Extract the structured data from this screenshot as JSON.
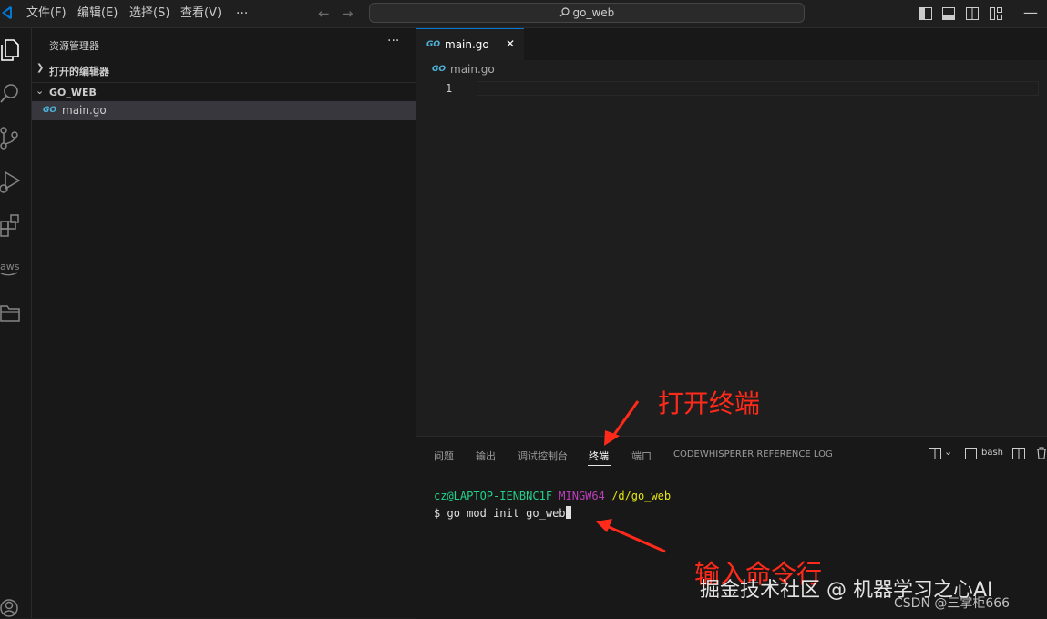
{
  "menu": [
    "文件(F)",
    "编辑(E)",
    "选择(S)",
    "查看(V)",
    "···"
  ],
  "search": {
    "text": "go_web"
  },
  "sidebar": {
    "title": "资源管理器",
    "more": "···",
    "open_editors": "打开的编辑器",
    "folder": "GO_WEB",
    "file": "main.go"
  },
  "editor": {
    "tab_label": "main.go",
    "tab_close": "✕",
    "breadcrumb": "main.go",
    "line_number": "1",
    "go_badge": "GO"
  },
  "panel": {
    "tabs": [
      "问题",
      "输出",
      "调试控制台",
      "终端",
      "端口",
      "CODEWHISPERER REFERENCE LOG"
    ],
    "active_tab": "终端",
    "shell": "bash"
  },
  "terminal": {
    "user_host": "cz@LAPTOP-IENBNC1F",
    "env": "MINGW64",
    "path": "/d/go_web",
    "prompt": "$",
    "command": "go mod init go_web"
  },
  "annotations": {
    "open_terminal": "打开终端",
    "input_command": "输入命令行"
  },
  "watermark": {
    "main": "掘金技术社区 @ 机器学习之心AI",
    "sub": "CSDN @三掌柜666"
  },
  "colors": {
    "accent": "#0078d4",
    "go_icon": "#4eb2d9",
    "terminal_green": "#23d18b",
    "terminal_magenta": "#bc3fbc",
    "terminal_yellow": "#e5e510",
    "annotation_red": "#ff2a1a"
  }
}
